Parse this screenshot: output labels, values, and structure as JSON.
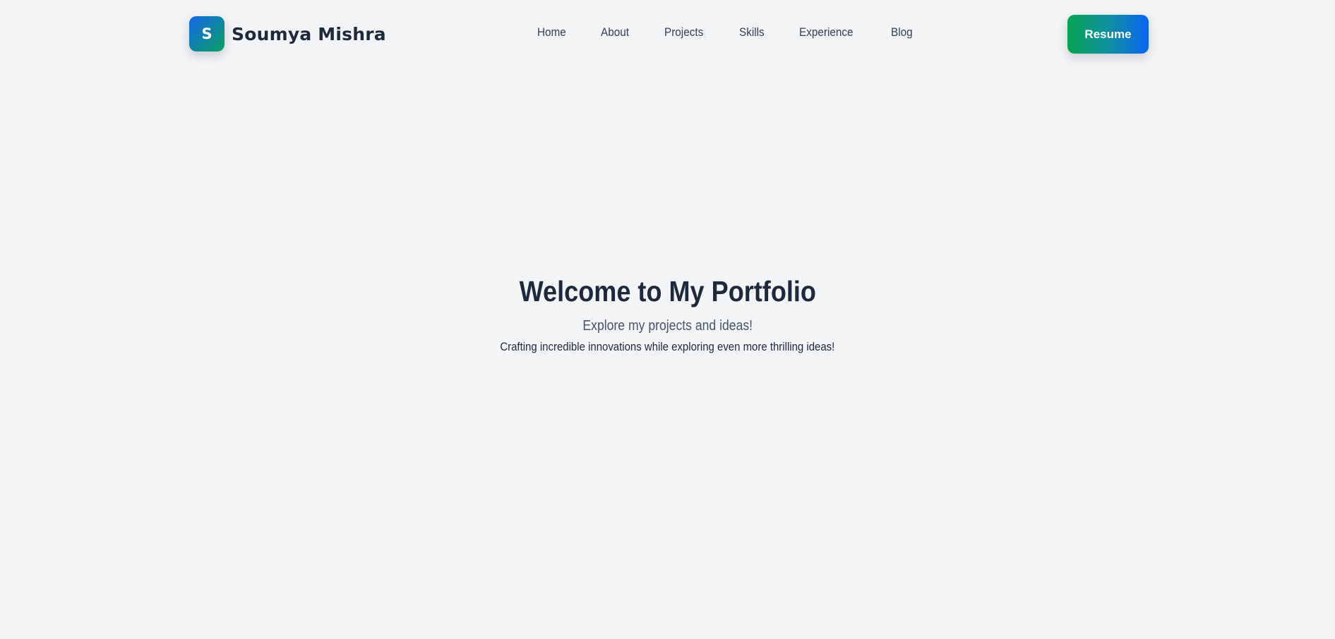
{
  "header": {
    "logo_letter": "S",
    "name": "Soumya Mishra",
    "nav": [
      {
        "label": "Home"
      },
      {
        "label": "About"
      },
      {
        "label": "Projects"
      },
      {
        "label": "Skills"
      },
      {
        "label": "Experience"
      },
      {
        "label": "Blog"
      }
    ],
    "resume_label": "Resume"
  },
  "hero": {
    "title": "Welcome to My Portfolio",
    "subtitle": "Explore my projects and ideas!",
    "tagline": "Crafting incredible innovations while exploring even more thrilling ideas!"
  },
  "colors": {
    "background": "#f3f4f6",
    "text": "#1e293b",
    "accent_blue": "#0b64f0",
    "accent_green": "#06a451"
  }
}
